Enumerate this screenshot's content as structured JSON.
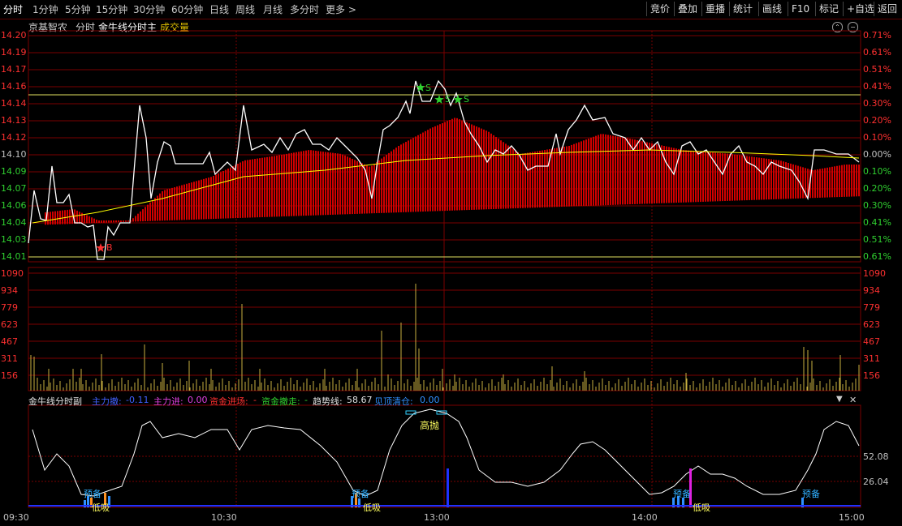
{
  "toolbar": {
    "tabs": [
      "分时",
      "1分钟",
      "5分钟",
      "15分钟",
      "30分钟",
      "60分钟",
      "日线",
      "周线",
      "月线",
      "多分时",
      "更多 >"
    ],
    "right_buttons": [
      "竞价",
      "叠加",
      "重播",
      "统计",
      "画线",
      "F10",
      "标记",
      "+自选",
      "返回"
    ]
  },
  "header": {
    "stock_name": "京基智农",
    "mode": "分时",
    "indicator": "金牛线分时主",
    "volume_label": "成交量"
  },
  "price_axis": {
    "left": [
      "14.20",
      "14.19",
      "14.17",
      "14.16",
      "14.14",
      "14.13",
      "14.12",
      "14.10",
      "14.09",
      "14.07",
      "14.06",
      "14.04",
      "14.03",
      "14.01"
    ],
    "right": [
      "0.71%",
      "0.61%",
      "0.51%",
      "0.41%",
      "0.30%",
      "0.20%",
      "0.10%",
      "0.00%",
      "0.10%",
      "0.20%",
      "0.30%",
      "0.41%",
      "0.51%",
      "0.61%"
    ]
  },
  "volume_axis": [
    "1090",
    "934",
    "779",
    "623",
    "467",
    "311",
    "156"
  ],
  "indicator_axis": [
    "52.08",
    "26.04"
  ],
  "indicator_bar": {
    "name": "金牛线分时副",
    "zl_label": "主力撤:",
    "zl_value": "-0.11",
    "zj_label": "主力进:",
    "zj_value": "0.00",
    "jc_label": "资金进场:",
    "jc_value": "-",
    "cz_label": "资金撤走:",
    "cz_value": "-",
    "qs_label": "趋势线:",
    "qs_value": "58.67",
    "jd_label": "见顶清仓:",
    "jd_value": "0.00"
  },
  "signals": {
    "buy": "B",
    "sell": "S",
    "top": "高抛",
    "prepare": "预备",
    "bottom": "低吸"
  },
  "time_axis": [
    "09:30",
    "10:30",
    "13:00",
    "14:00",
    "15:00"
  ],
  "colors": {
    "grid": "#7a0000",
    "price": "#ffffff",
    "bars": "#d00000",
    "avg": "#ffff00",
    "volume": "#c8b040"
  }
}
